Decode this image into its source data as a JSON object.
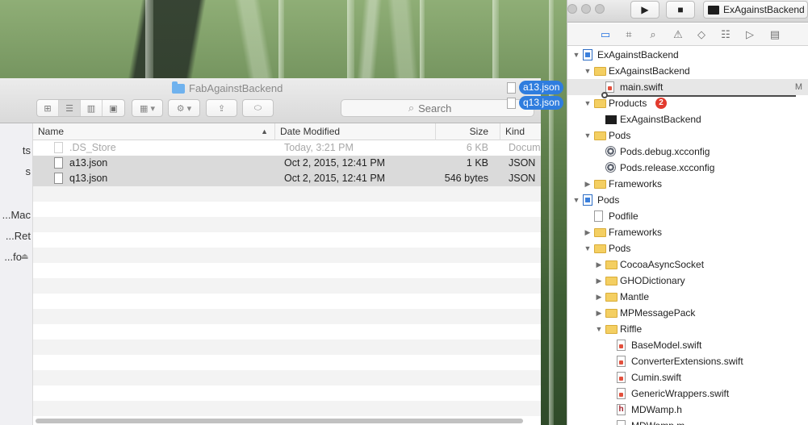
{
  "finder": {
    "title": "FabAgainstBackend",
    "search_placeholder": "Search",
    "sidebar_fragments": [
      "ts",
      "s",
      "Mac...",
      "Ret...",
      "fo..."
    ],
    "columns": {
      "name": "Name",
      "date_modified": "Date Modified",
      "size": "Size",
      "kind": "Kind"
    },
    "files": [
      {
        "name": ".DS_Store",
        "date": "Today, 3:21 PM",
        "size": "6 KB",
        "kind": "Docum"
      },
      {
        "name": "a13.json",
        "date": "Oct 2, 2015, 12:41 PM",
        "size": "1 KB",
        "kind": "JSON"
      },
      {
        "name": "q13.json",
        "date": "Oct 2, 2015, 12:41 PM",
        "size": "546 bytes",
        "kind": "JSON"
      }
    ]
  },
  "drag": {
    "items": [
      "a13.json",
      "q13.json"
    ]
  },
  "xcode": {
    "scheme": "ExAgainstBackend",
    "tree": [
      {
        "label": "ExAgainstBackend",
        "depth": 0,
        "disc": "open",
        "icon": "project"
      },
      {
        "label": "ExAgainstBackend",
        "depth": 1,
        "disc": "open",
        "icon": "folder"
      },
      {
        "label": "main.swift",
        "depth": 2,
        "disc": "",
        "icon": "swift",
        "badge": "M",
        "selected": true
      },
      {
        "label": "Products",
        "depth": 1,
        "disc": "open",
        "icon": "folder",
        "error_count": "2"
      },
      {
        "label": "ExAgainstBackend",
        "depth": 2,
        "disc": "",
        "icon": "terminal"
      },
      {
        "label": "Pods",
        "depth": 1,
        "disc": "open",
        "icon": "folder"
      },
      {
        "label": "Pods.debug.xcconfig",
        "depth": 2,
        "disc": "",
        "icon": "config"
      },
      {
        "label": "Pods.release.xcconfig",
        "depth": 2,
        "disc": "",
        "icon": "config"
      },
      {
        "label": "Frameworks",
        "depth": 1,
        "disc": "closed",
        "icon": "folder"
      },
      {
        "label": "Pods",
        "depth": 0,
        "disc": "open",
        "icon": "project"
      },
      {
        "label": "Podfile",
        "depth": 1,
        "disc": "",
        "icon": "file"
      },
      {
        "label": "Frameworks",
        "depth": 1,
        "disc": "closed",
        "icon": "folder"
      },
      {
        "label": "Pods",
        "depth": 1,
        "disc": "open",
        "icon": "folder"
      },
      {
        "label": "CocoaAsyncSocket",
        "depth": 2,
        "disc": "closed",
        "icon": "folder"
      },
      {
        "label": "GHODictionary",
        "depth": 2,
        "disc": "closed",
        "icon": "folder"
      },
      {
        "label": "Mantle",
        "depth": 2,
        "disc": "closed",
        "icon": "folder"
      },
      {
        "label": "MPMessagePack",
        "depth": 2,
        "disc": "closed",
        "icon": "folder"
      },
      {
        "label": "Riffle",
        "depth": 2,
        "disc": "open",
        "icon": "folder"
      },
      {
        "label": "BaseModel.swift",
        "depth": 3,
        "disc": "",
        "icon": "swift"
      },
      {
        "label": "ConverterExtensions.swift",
        "depth": 3,
        "disc": "",
        "icon": "swift"
      },
      {
        "label": "Cumin.swift",
        "depth": 3,
        "disc": "",
        "icon": "swift"
      },
      {
        "label": "GenericWrappers.swift",
        "depth": 3,
        "disc": "",
        "icon": "swift"
      },
      {
        "label": "MDWamp.h",
        "depth": 3,
        "disc": "",
        "icon": "header"
      },
      {
        "label": "MDWamp.m",
        "depth": 3,
        "disc": "",
        "icon": "file"
      }
    ]
  }
}
